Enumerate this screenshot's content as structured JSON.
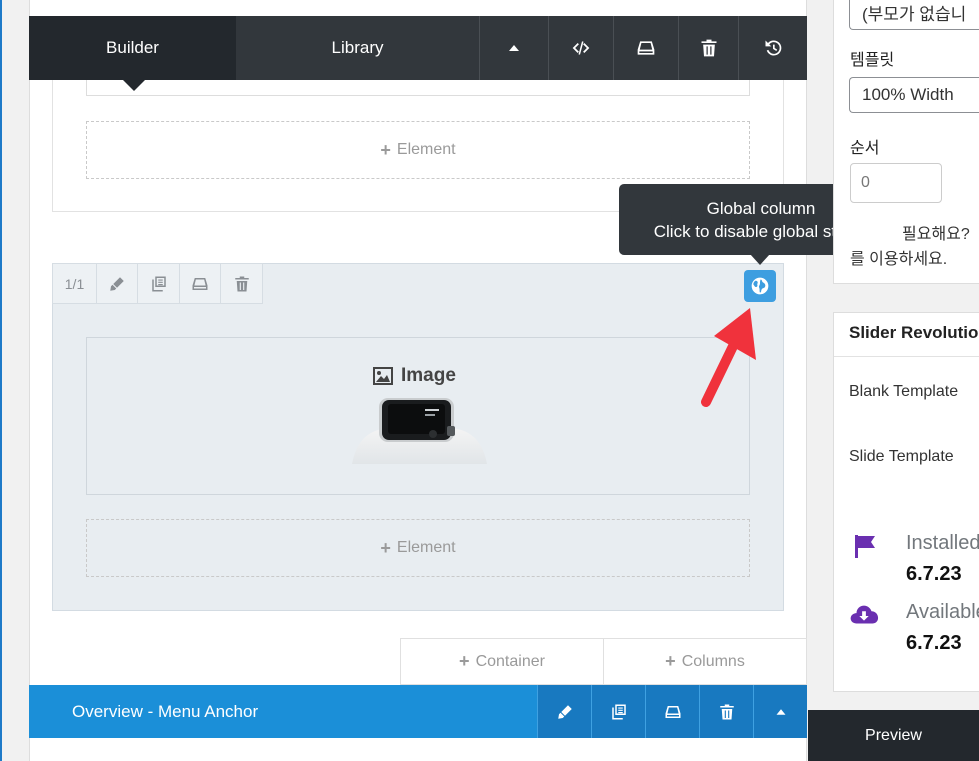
{
  "builder_toolbar": {
    "tabs": [
      {
        "label": "Builder",
        "active": true
      },
      {
        "label": "Library",
        "active": false
      }
    ],
    "icons": [
      "caret-up-icon",
      "code-icon",
      "save-icon",
      "trash-icon",
      "history-icon"
    ]
  },
  "upper_section": {
    "add_element_label": "Element"
  },
  "global_column": {
    "size_label": "1/1",
    "controls": [
      "edit-icon",
      "duplicate-icon",
      "save-icon",
      "trash-icon"
    ],
    "global_icon": "globe-icon",
    "tooltip": {
      "line1": "Global column",
      "line2": "Click to disable global status"
    },
    "image_element": {
      "title": "Image"
    },
    "add_element_label": "Element"
  },
  "add_buttons": {
    "container_label": "Container",
    "columns_label": "Columns"
  },
  "anchor_bar": {
    "title": "Overview - Menu Anchor",
    "icons": [
      "edit-icon",
      "duplicate-icon",
      "save-icon",
      "trash-icon",
      "caret-up-icon"
    ]
  },
  "right_panel": {
    "parent_value": "(부모가 없습니",
    "template_label": "템플릿",
    "template_value": "100% Width",
    "order_label": "순서",
    "order_value": "0",
    "help_line1": "필요해요?",
    "help_line2": "를 이용하세요."
  },
  "slider_panel": {
    "title": "Slider Revolution",
    "blank_template": "Blank Template",
    "slide_template": "Slide Template",
    "installed_label": "Installed",
    "installed_version": "6.7.23",
    "available_label": "Available",
    "available_version": "6.7.23"
  },
  "preview_button": "Preview",
  "colors": {
    "toolbar_dark": "#32373c",
    "accent_blue": "#1b8fd8",
    "arrow_red": "#f0323c",
    "flag_purple": "#6a2fb0"
  }
}
